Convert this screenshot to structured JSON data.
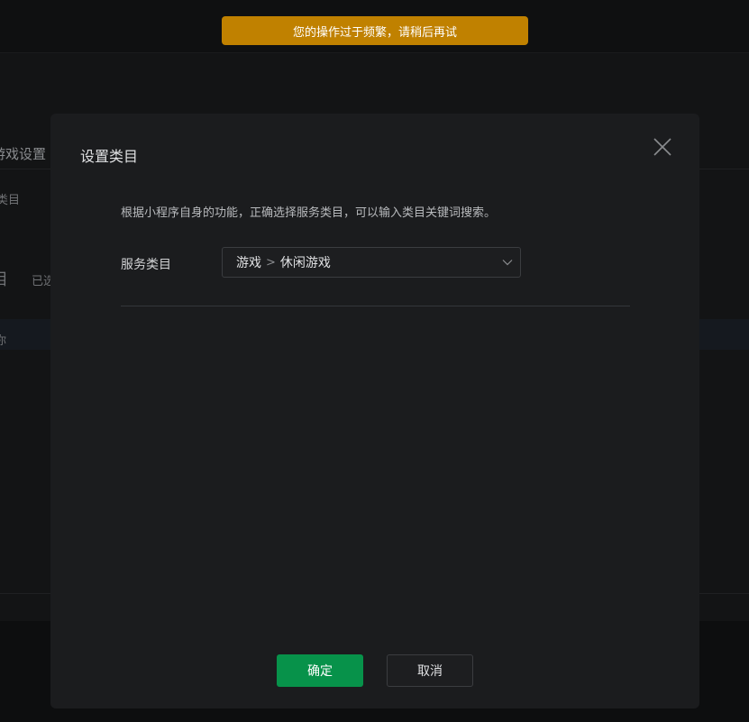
{
  "toast": {
    "message": "您的操作过于频繁，请稍后再试"
  },
  "background": {
    "tab_title": "游戏设置",
    "label": "类目",
    "big_char": "目",
    "selected_text": "已选",
    "row_text": "你"
  },
  "dialog": {
    "title": "设置类目",
    "close_icon": "close-icon",
    "description": "根据小程序自身的功能，正确选择服务类目，可以输入类目关键词搜索。",
    "field_label": "服务类目",
    "select": {
      "level1": "游戏",
      "separator": ">",
      "level2": "休闲游戏",
      "chevron_icon": "chevron-down-icon"
    },
    "confirm_label": "确定",
    "cancel_label": "取消"
  },
  "colors": {
    "toast_bg": "#c08100",
    "primary": "#07924a",
    "dialog_bg": "#1b1c1e",
    "page_bg": "#0d0e0f"
  }
}
